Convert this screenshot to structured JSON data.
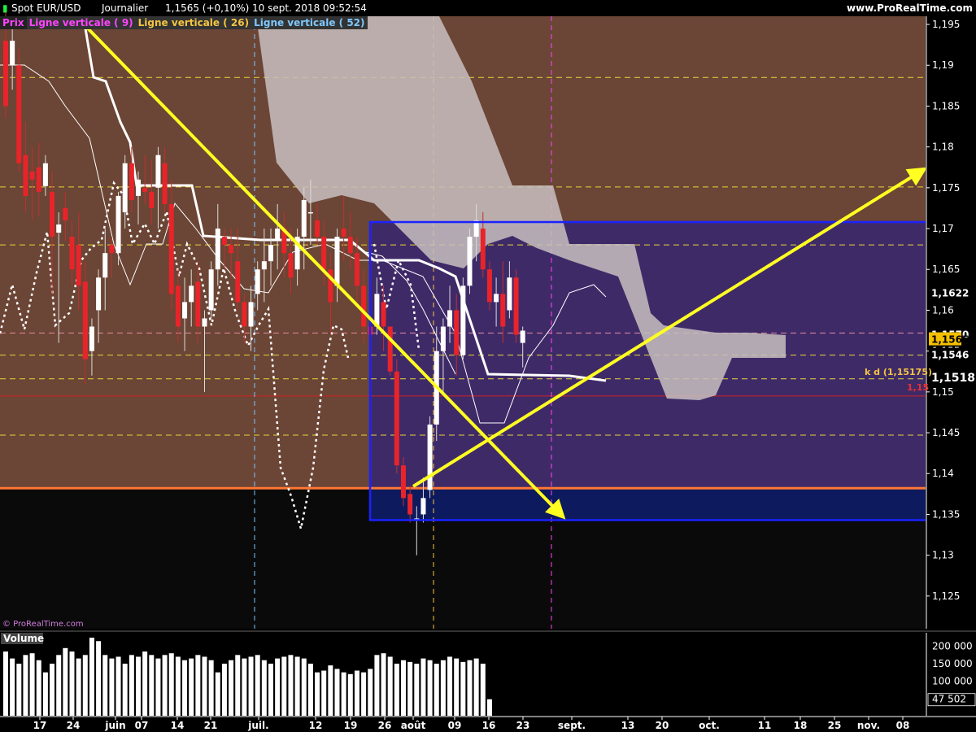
{
  "header": {
    "instrument": "Spot EUR/USD",
    "period": "Journalier",
    "price_change": "1,1565 (+0,10%)",
    "datetime": "10 sept. 2018 09:52:54",
    "site": "www.ProRealTime.com",
    "watermark": "© ProRealTime.com"
  },
  "legend": [
    {
      "label": "Prix",
      "color": "#ff44ff",
      "bg": "#222222"
    },
    {
      "label": "Ligne verticale ( 9)",
      "color": "#ff44ff",
      "bg": "#333333"
    },
    {
      "label": "Ligne verticale ( 26)",
      "color": "#f5c542",
      "bg": "#333333"
    },
    {
      "label": "Ligne verticale ( 52)",
      "color": "#7ec8ff",
      "bg": "#333333"
    }
  ],
  "colors": {
    "bg_top": "#6b4535",
    "bg_box": "#3f2a68",
    "bg_box_low": "#0d1a5e",
    "bg_low": "#0a0a0a",
    "bull": "#ffffff",
    "bear": "#e8242a",
    "cloud": "#c8c0c0",
    "yellow": "#ffff22",
    "orange": "#ff7733",
    "box": "#1a22ff"
  },
  "chart_data": {
    "type": "candlestick",
    "ylim": [
      1.121,
      1.196
    ],
    "y_ticks": [
      "1,125",
      "1,13",
      "1,135",
      "1,14",
      "1,145",
      "1,15",
      "1,155",
      "1,16",
      "1,165",
      "1,17",
      "1,175",
      "1,18",
      "1,185",
      "1,19",
      "1,195"
    ],
    "x_ticks": [
      "17",
      "24",
      "juin",
      "07",
      "14",
      "21",
      "juil.",
      "12",
      "19",
      "26",
      "août",
      "09",
      "16",
      "23",
      "sept.",
      "13",
      "20",
      "oct.",
      "11",
      "18",
      "25",
      "nov.",
      "08"
    ],
    "price_labels": {
      "high_tag": "1,1622",
      "last_close": "1,1565",
      "prev_tag": "1,1570",
      "level_tag": "1,1546",
      "kijun_tag": "1,1518",
      "kd_label": "k d (1,15175)",
      "round_level": "1,15"
    },
    "levels": {
      "yellow_dashed": [
        1.1885,
        1.1751,
        1.168,
        1.1545,
        1.1516,
        1.1447
      ],
      "red_line": 1.1495,
      "pink_dashed": 1.1572,
      "orange_support": 1.1382,
      "zone_top": 1.1708,
      "zone_bottom": 1.1343
    },
    "candles": [
      [
        1.193,
        1.1965,
        1.1835,
        1.185
      ],
      [
        1.19,
        1.1945,
        1.187,
        1.193
      ],
      [
        1.19,
        1.192,
        1.177,
        1.178
      ],
      [
        1.179,
        1.183,
        1.172,
        1.174
      ],
      [
        1.177,
        1.18,
        1.171,
        1.176
      ],
      [
        1.1775,
        1.1805,
        1.1715,
        1.1745
      ],
      [
        1.1752,
        1.179,
        1.174,
        1.178
      ],
      [
        1.1745,
        1.177,
        1.162,
        1.169
      ],
      [
        1.1695,
        1.172,
        1.156,
        1.1705
      ],
      [
        1.1725,
        1.1745,
        1.1685,
        1.171
      ],
      [
        1.169,
        1.171,
        1.163,
        1.165
      ],
      [
        1.168,
        1.172,
        1.16,
        1.163
      ],
      [
        1.1635,
        1.166,
        1.151,
        1.154
      ],
      [
        1.155,
        1.159,
        1.152,
        1.158
      ],
      [
        1.16,
        1.165,
        1.156,
        1.164
      ],
      [
        1.164,
        1.17,
        1.16,
        1.167
      ],
      [
        1.168,
        1.169,
        1.164,
        1.167
      ],
      [
        1.167,
        1.1745,
        1.1655,
        1.174
      ],
      [
        1.172,
        1.179,
        1.17,
        1.178
      ],
      [
        1.178,
        1.18,
        1.172,
        1.1735
      ],
      [
        1.174,
        1.177,
        1.1705,
        1.176
      ],
      [
        1.175,
        1.179,
        1.173,
        1.1745
      ],
      [
        1.1745,
        1.1785,
        1.1705,
        1.1725
      ],
      [
        1.175,
        1.18,
        1.17,
        1.179
      ],
      [
        1.178,
        1.18,
        1.172,
        1.173
      ],
      [
        1.173,
        1.176,
        1.16,
        1.162
      ],
      [
        1.163,
        1.165,
        1.156,
        1.158
      ],
      [
        1.159,
        1.164,
        1.155,
        1.161
      ],
      [
        1.161,
        1.165,
        1.158,
        1.163
      ],
      [
        1.1635,
        1.166,
        1.156,
        1.158
      ],
      [
        1.158,
        1.16,
        1.15,
        1.159
      ],
      [
        1.16,
        1.166,
        1.159,
        1.165
      ],
      [
        1.165,
        1.173,
        1.163,
        1.17
      ],
      [
        1.169,
        1.17,
        1.165,
        1.168
      ],
      [
        1.168,
        1.17,
        1.164,
        1.167
      ],
      [
        1.166,
        1.17,
        1.16,
        1.161
      ],
      [
        1.161,
        1.162,
        1.156,
        1.158
      ],
      [
        1.158,
        1.163,
        1.155,
        1.161
      ],
      [
        1.162,
        1.166,
        1.16,
        1.165
      ],
      [
        1.165,
        1.17,
        1.161,
        1.166
      ],
      [
        1.166,
        1.17,
        1.163,
        1.168
      ],
      [
        1.1685,
        1.173,
        1.165,
        1.17
      ],
      [
        1.17,
        1.172,
        1.164,
        1.167
      ],
      [
        1.167,
        1.17,
        1.162,
        1.164
      ],
      [
        1.165,
        1.17,
        1.163,
        1.169
      ],
      [
        1.169,
        1.175,
        1.165,
        1.1735
      ],
      [
        1.172,
        1.176,
        1.168,
        1.172
      ],
      [
        1.171,
        1.173,
        1.168,
        1.169
      ],
      [
        1.169,
        1.171,
        1.163,
        1.165
      ],
      [
        1.165,
        1.167,
        1.157,
        1.161
      ],
      [
        1.163,
        1.17,
        1.161,
        1.169
      ],
      [
        1.17,
        1.174,
        1.166,
        1.169
      ],
      [
        1.169,
        1.172,
        1.165,
        1.167
      ],
      [
        1.167,
        1.169,
        1.161,
        1.163
      ],
      [
        1.163,
        1.165,
        1.156,
        1.158
      ],
      [
        1.158,
        1.16,
        1.156,
        1.157
      ],
      [
        1.158,
        1.164,
        1.157,
        1.162
      ],
      [
        1.161,
        1.163,
        1.155,
        1.158
      ],
      [
        1.158,
        1.158,
        1.152,
        1.1525
      ],
      [
        1.1525,
        1.154,
        1.14,
        1.141
      ],
      [
        1.141,
        1.142,
        1.136,
        1.137
      ],
      [
        1.1375,
        1.1385,
        1.134,
        1.135
      ],
      [
        1.1345,
        1.136,
        1.13,
        1.1345
      ],
      [
        1.135,
        1.1395,
        1.134,
        1.137
      ],
      [
        1.138,
        1.147,
        1.137,
        1.146
      ],
      [
        1.146,
        1.158,
        1.144,
        1.155
      ],
      [
        1.155,
        1.159,
        1.15,
        1.158
      ],
      [
        1.158,
        1.163,
        1.156,
        1.16
      ],
      [
        1.16,
        1.162,
        1.152,
        1.1545
      ],
      [
        1.1545,
        1.164,
        1.154,
        1.163
      ],
      [
        1.163,
        1.17,
        1.162,
        1.169
      ],
      [
        1.169,
        1.173,
        1.166,
        1.171
      ],
      [
        1.17,
        1.172,
        1.164,
        1.165
      ],
      [
        1.165,
        1.166,
        1.16,
        1.161
      ],
      [
        1.161,
        1.164,
        1.158,
        1.162
      ],
      [
        1.162,
        1.166,
        1.156,
        1.158
      ],
      [
        1.16,
        1.166,
        1.159,
        1.164
      ],
      [
        1.164,
        1.165,
        1.156,
        1.157
      ],
      [
        1.156,
        1.158,
        1.153,
        1.1575
      ]
    ],
    "volume": {
      "y_ticks": [
        "200 000",
        "150 000",
        "100 000",
        "47 502"
      ],
      "ylim": [
        0,
        225000
      ],
      "values": [
        185000,
        165000,
        150000,
        175000,
        180000,
        160000,
        125000,
        150000,
        175000,
        195000,
        185000,
        165000,
        175000,
        225000,
        215000,
        175000,
        165000,
        170000,
        150000,
        175000,
        170000,
        185000,
        175000,
        165000,
        175000,
        180000,
        170000,
        160000,
        165000,
        175000,
        170000,
        160000,
        125000,
        150000,
        160000,
        175000,
        165000,
        170000,
        175000,
        160000,
        150000,
        165000,
        170000,
        175000,
        170000,
        165000,
        150000,
        125000,
        130000,
        145000,
        135000,
        125000,
        120000,
        130000,
        125000,
        135000,
        175000,
        180000,
        170000,
        150000,
        160000,
        155000,
        150000,
        165000,
        160000,
        150000,
        160000,
        170000,
        165000,
        155000,
        160000,
        165000,
        150000,
        47502
      ]
    }
  }
}
